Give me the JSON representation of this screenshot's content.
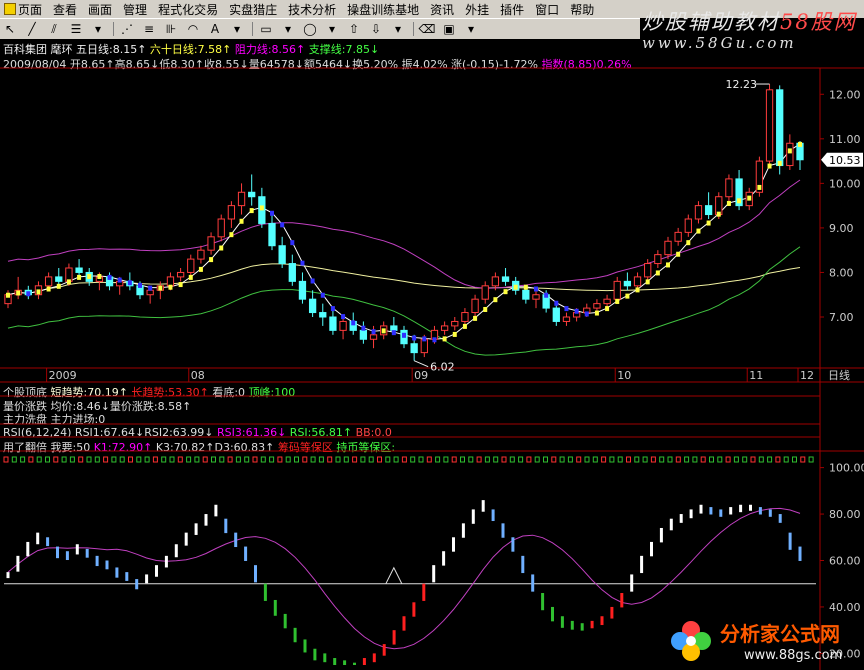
{
  "menubar": {
    "items": [
      "页面",
      "查看",
      "画面",
      "管理",
      "程式化交易",
      "实盘猎庄",
      "技术分析",
      "操盘训练基地",
      "资讯",
      "外挂",
      "插件",
      "窗口",
      "帮助"
    ]
  },
  "watermark": {
    "text_pre": "炒股辅助教材",
    "text_hl": "58股网",
    "url": "www.58Gu.com"
  },
  "logo": {
    "name": "分析家公式网",
    "url": "www.88gs.com"
  },
  "header": {
    "stock": "百科集团",
    "indicator": "麾环",
    "ma5": "五日线:8.15↑",
    "ma60": "六十日线:7.58↑",
    "resist": "阻力线:8.56↑",
    "support": "支撑线:7.85↓",
    "quote": "2009/08/04 开8.65↑高8.65↓低8.30↑收8.55↓量64578↓额5464↓换5.20% 振4.02% 涨(-0.15)-1.72%",
    "index_label": "指数(8.85)0.26%"
  },
  "indicator_rows": {
    "row1_a": "个股顶底",
    "row1_b": "短趋势:70.19↑",
    "row1_c": "长趋势:53.30↑",
    "row1_d": "看底:0",
    "row1_e": "顶峰:100",
    "row2": "量价涨跌 均价:8.46↓量价涨跌:8.58↑",
    "row3": "主力洗盘 主力进场:0",
    "rsi_a": "RSI(6,12,24) RSI1:67.64↓RSI2:63.99↓",
    "rsi_b": "RSI3:61.36↓",
    "rsi_c": "RSI:56.81↑",
    "rsi_d": "BB:0.0",
    "kd_a": "用了翻倍 我要:50",
    "kd_b": "K1:72.90↑",
    "kd_c": "K3:70.82↑D3:60.83↑",
    "kd_d": "筹码等保区",
    "kd_e": "持币等保区:"
  },
  "chart_data": [
    {
      "type": "candlestick",
      "y_ticks": [
        "12.00",
        "11.00",
        "10.00",
        "9.00",
        "8.00",
        "7.00"
      ],
      "ylim": [
        5.9,
        12.5
      ],
      "x_labels": [
        "2009",
        "08",
        "09",
        "10",
        "11",
        "12",
        "日线"
      ],
      "annotations": {
        "high": "12.23",
        "low": "6.02",
        "last": "10.53"
      },
      "candles": [
        [
          7.3,
          7.6,
          7.2,
          7.5
        ],
        [
          7.5,
          7.9,
          7.4,
          7.6
        ],
        [
          7.6,
          7.7,
          7.4,
          7.5
        ],
        [
          7.5,
          7.8,
          7.4,
          7.7
        ],
        [
          7.7,
          8.0,
          7.6,
          7.9
        ],
        [
          7.9,
          8.1,
          7.7,
          7.8
        ],
        [
          7.8,
          8.2,
          7.7,
          8.1
        ],
        [
          8.1,
          8.3,
          7.9,
          8.0
        ],
        [
          8.0,
          8.1,
          7.7,
          7.8
        ],
        [
          7.8,
          8.0,
          7.6,
          7.9
        ],
        [
          7.9,
          8.0,
          7.6,
          7.7
        ],
        [
          7.7,
          7.9,
          7.5,
          7.8
        ],
        [
          7.8,
          8.0,
          7.6,
          7.7
        ],
        [
          7.7,
          7.8,
          7.4,
          7.5
        ],
        [
          7.5,
          7.7,
          7.3,
          7.6
        ],
        [
          7.6,
          7.8,
          7.4,
          7.7
        ],
        [
          7.7,
          8.0,
          7.6,
          7.9
        ],
        [
          7.9,
          8.1,
          7.8,
          8.0
        ],
        [
          8.0,
          8.4,
          7.9,
          8.3
        ],
        [
          8.3,
          8.6,
          8.2,
          8.5
        ],
        [
          8.5,
          8.9,
          8.4,
          8.8
        ],
        [
          8.8,
          9.3,
          8.7,
          9.2
        ],
        [
          9.2,
          9.6,
          9.0,
          9.5
        ],
        [
          9.5,
          10.0,
          9.3,
          9.8
        ],
        [
          9.8,
          10.2,
          9.5,
          9.7
        ],
        [
          9.7,
          9.9,
          9.0,
          9.1
        ],
        [
          9.1,
          9.3,
          8.5,
          8.6
        ],
        [
          8.6,
          8.8,
          8.1,
          8.2
        ],
        [
          8.2,
          8.4,
          7.7,
          7.8
        ],
        [
          7.8,
          8.0,
          7.3,
          7.4
        ],
        [
          7.4,
          7.6,
          7.0,
          7.1
        ],
        [
          7.1,
          7.3,
          6.8,
          7.0
        ],
        [
          7.0,
          7.2,
          6.6,
          6.7
        ],
        [
          6.7,
          7.0,
          6.5,
          6.9
        ],
        [
          6.9,
          7.1,
          6.6,
          6.7
        ],
        [
          6.7,
          6.9,
          6.4,
          6.5
        ],
        [
          6.5,
          6.8,
          6.3,
          6.6
        ],
        [
          6.6,
          6.9,
          6.5,
          6.8
        ],
        [
          6.8,
          7.0,
          6.6,
          6.7
        ],
        [
          6.7,
          6.8,
          6.3,
          6.4
        ],
        [
          6.4,
          6.6,
          6.02,
          6.2
        ],
        [
          6.2,
          6.6,
          6.1,
          6.5
        ],
        [
          6.5,
          6.8,
          6.4,
          6.7
        ],
        [
          6.7,
          6.9,
          6.6,
          6.8
        ],
        [
          6.8,
          7.0,
          6.7,
          6.9
        ],
        [
          6.9,
          7.2,
          6.8,
          7.1
        ],
        [
          7.1,
          7.5,
          7.0,
          7.4
        ],
        [
          7.4,
          7.8,
          7.3,
          7.7
        ],
        [
          7.7,
          8.0,
          7.6,
          7.9
        ],
        [
          7.9,
          8.1,
          7.7,
          7.8
        ],
        [
          7.8,
          7.9,
          7.5,
          7.6
        ],
        [
          7.6,
          7.7,
          7.3,
          7.4
        ],
        [
          7.4,
          7.6,
          7.2,
          7.5
        ],
        [
          7.5,
          7.6,
          7.1,
          7.2
        ],
        [
          7.2,
          7.3,
          6.8,
          6.9
        ],
        [
          6.9,
          7.1,
          6.8,
          7.0
        ],
        [
          7.0,
          7.2,
          6.9,
          7.1
        ],
        [
          7.1,
          7.3,
          7.0,
          7.2
        ],
        [
          7.2,
          7.4,
          7.1,
          7.3
        ],
        [
          7.3,
          7.5,
          7.2,
          7.4
        ],
        [
          7.4,
          7.9,
          7.3,
          7.8
        ],
        [
          7.8,
          8.0,
          7.6,
          7.7
        ],
        [
          7.7,
          8.0,
          7.6,
          7.9
        ],
        [
          7.9,
          8.3,
          7.8,
          8.2
        ],
        [
          8.2,
          8.5,
          8.1,
          8.4
        ],
        [
          8.4,
          8.8,
          8.3,
          8.7
        ],
        [
          8.7,
          9.0,
          8.6,
          8.9
        ],
        [
          8.9,
          9.3,
          8.8,
          9.2
        ],
        [
          9.2,
          9.6,
          9.1,
          9.5
        ],
        [
          9.5,
          9.8,
          9.2,
          9.3
        ],
        [
          9.3,
          9.8,
          9.2,
          9.7
        ],
        [
          9.7,
          10.2,
          9.6,
          10.1
        ],
        [
          10.1,
          10.3,
          9.4,
          9.5
        ],
        [
          9.5,
          9.9,
          9.4,
          9.8
        ],
        [
          9.8,
          10.6,
          9.7,
          10.5
        ],
        [
          10.5,
          12.23,
          10.4,
          12.1
        ],
        [
          12.1,
          12.2,
          10.2,
          10.4
        ],
        [
          10.4,
          11.1,
          10.3,
          10.9
        ],
        [
          10.9,
          10.95,
          10.3,
          10.53
        ]
      ]
    },
    {
      "type": "bar",
      "name": "oscillator",
      "y_ticks": [
        "100.00",
        "80.00",
        "60.00",
        "40.00",
        "20.00"
      ],
      "ylim": [
        15,
        105
      ],
      "values": [
        55,
        62,
        68,
        72,
        70,
        66,
        64,
        67,
        65,
        62,
        60,
        57,
        55,
        52,
        54,
        58,
        62,
        67,
        72,
        76,
        80,
        84,
        78,
        72,
        66,
        58,
        50,
        43,
        37,
        31,
        26,
        22,
        20,
        18,
        17,
        16,
        18,
        20,
        24,
        30,
        36,
        42,
        50,
        58,
        64,
        70,
        76,
        82,
        86,
        82,
        76,
        70,
        62,
        54,
        46,
        40,
        36,
        34,
        33,
        34,
        36,
        40,
        46,
        54,
        62,
        68,
        74,
        78,
        80,
        82,
        84,
        83,
        82,
        83,
        84,
        84,
        83,
        82,
        80,
        72,
        66
      ]
    }
  ]
}
